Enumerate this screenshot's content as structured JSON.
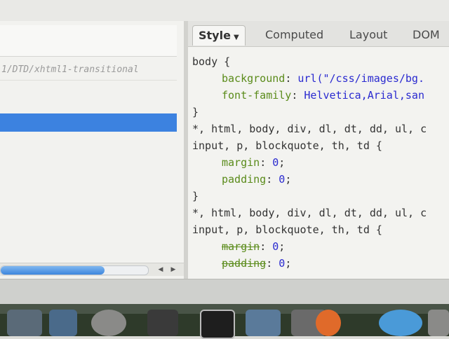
{
  "tabs": [
    {
      "label": "Style",
      "active": true,
      "has_dropdown": true
    },
    {
      "label": "Computed"
    },
    {
      "label": "Layout"
    },
    {
      "label": "DOM"
    }
  ],
  "left": {
    "doctype_text": "1/DTD/xhtml1-transitional"
  },
  "code": {
    "l1": "body {",
    "l2_prop": "background",
    "l2_val": "url(\"/css/images/bg.",
    "l3_prop": "font-family",
    "l3_val": "Helvetica,Arial,san",
    "l4": "}",
    "l5": "*, html, body, div, dl, dt, dd, ul, c",
    "l6": "input, p, blockquote, th, td {",
    "l7_prop": "margin",
    "l7_val": "0",
    "l8_prop": "padding",
    "l8_val": "0",
    "l9": "}",
    "l10": "*, html, body, div, dl, dt, dd, ul, c",
    "l11": "input, p, blockquote, th, td {",
    "l12_prop": "margin",
    "l12_val": "0",
    "l13_prop": "padding",
    "l13_val": "0"
  },
  "icons": {
    "scroll_left": "◀",
    "scroll_right": "▶",
    "dropdown": "▼"
  },
  "colors": {
    "selection": "#3c82e0",
    "property": "#5a8b1a",
    "value": "#2a2ad0"
  }
}
